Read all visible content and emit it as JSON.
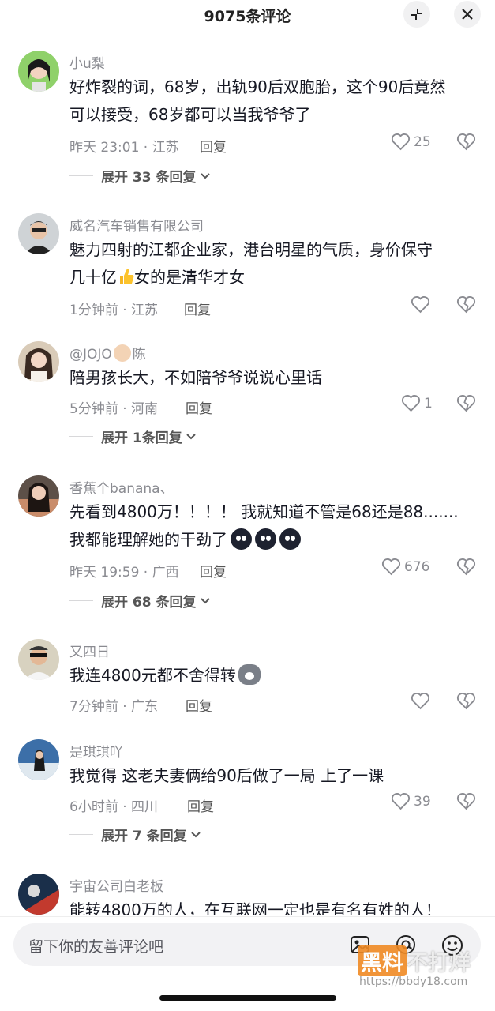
{
  "header": {
    "title": "9075条评论"
  },
  "comments": [
    {
      "username": "小u梨",
      "text": "好炸裂的词，68岁，出轨90后双胞胎，这个90后竟然\n可以接受，68岁都可以当我爷爷了",
      "meta": "昨天 23:01 · 江苏",
      "reply": "回复",
      "likes": "25",
      "expand": "展开 33 条回复"
    },
    {
      "username": "威名汽车销售有限公司",
      "text_a": "魅力四射的江都企业家，港台明星的气质，身价保守\n几十亿",
      "text_b": "女的是清华才女",
      "meta": "1分钟前 · 江苏",
      "reply": "回复",
      "likes": ""
    },
    {
      "username_a": "@JOJO",
      "username_b": "陈",
      "text": "陪男孩长大，不如陪爷爷说说心里话",
      "meta": "5分钟前 · 河南",
      "reply": "回复",
      "likes": "1",
      "expand": "展开 1条回复"
    },
    {
      "username": "香蕉个banana、",
      "text_a": "先看到4800万！！！！ 我就知道不管是68还是88.......\n我都能理解她的干劲了",
      "meta": "昨天 19:59 · 广西",
      "reply": "回复",
      "likes": "676",
      "expand": "展开 68 条回复"
    },
    {
      "username": "又四日",
      "text": "我连4800元都不舍得转",
      "meta": "7分钟前 · 广东",
      "reply": "回复",
      "likes": ""
    },
    {
      "username": "是琪琪吖",
      "text": "我觉得 这老夫妻俩给90后做了一局 上了一课",
      "meta": "6小时前 · 四川",
      "reply": "回复",
      "likes": "39",
      "expand": "展开 7 条回复"
    },
    {
      "username": "宇宙公司白老板",
      "text": "能转4800万的人，在互联网一定也是有名有姓的人！"
    }
  ],
  "footer": {
    "placeholder": "留下你的友善评论吧",
    "watermark_main": "黑料",
    "watermark_side": "不打烊",
    "watermark_url": "https://bbdy18.com"
  },
  "colors": {
    "like_icon": "#8a8b91",
    "text": "#161823",
    "muted": "#8a8b91",
    "watermark": "#f08a24"
  },
  "icons": [
    "collapse-icon",
    "close-icon",
    "heart-icon",
    "broken-heart-icon",
    "image-icon",
    "at-icon",
    "emoji-icon"
  ]
}
